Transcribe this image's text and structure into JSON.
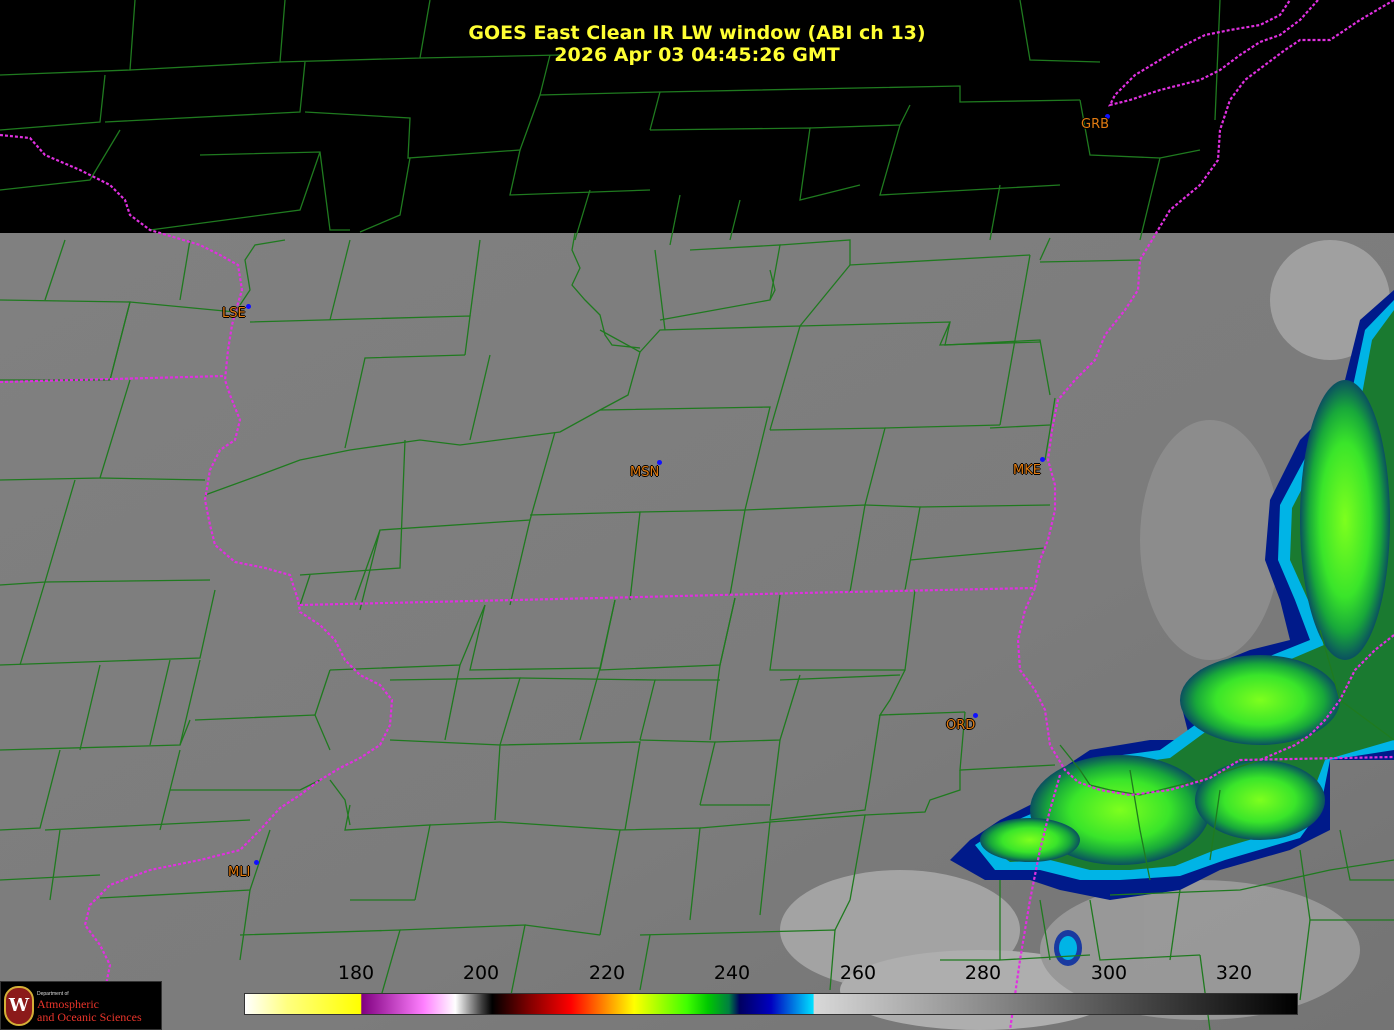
{
  "header": {
    "title": "GOES East Clean IR LW window (ABI ch 13)",
    "timestamp": "2026 Apr 03  04:45:26 GMT"
  },
  "cities": [
    {
      "code": "GRB"
    },
    {
      "code": "LSE"
    },
    {
      "code": "MSN"
    },
    {
      "code": "MKE"
    },
    {
      "code": "ORD"
    },
    {
      "code": "MLI"
    }
  ],
  "colorbar": {
    "ticks": [
      "180",
      "200",
      "220",
      "240",
      "260",
      "280",
      "300",
      "320"
    ]
  },
  "logo": {
    "dept": "Department of",
    "line1": "Atmospheric",
    "line2": "and Oceanic Sciences",
    "seal": "W"
  },
  "colors": {
    "title": "#ffff33",
    "city_label": "#e07a10",
    "county_lines": "#1f7a1f",
    "state_lines": "#e030e0",
    "cold_clouds": "#33dd22",
    "clear_sky": "#7a7a7a"
  }
}
